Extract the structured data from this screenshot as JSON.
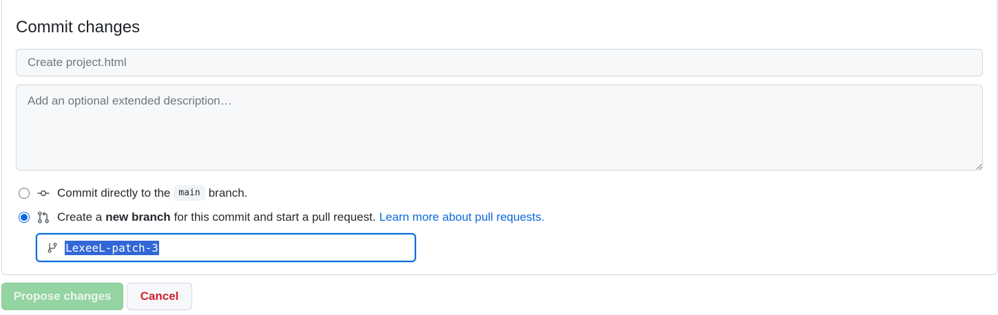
{
  "commit": {
    "title": "Commit changes",
    "summary_placeholder": "Create project.html",
    "description_placeholder": "Add an optional extended description…"
  },
  "options": {
    "direct": {
      "prefix": "Commit directly to the",
      "branch": "main",
      "suffix": "branch.",
      "selected": false,
      "icon": "git-commit-icon"
    },
    "new_branch": {
      "prefix": "Create a",
      "bold": "new branch",
      "middle": "for this commit and start a pull request.",
      "link": "Learn more about pull requests.",
      "selected": true,
      "icon": "git-pull-request-icon"
    }
  },
  "branch_name": {
    "value": "LexeeL-patch-3",
    "icon": "git-branch-icon"
  },
  "buttons": {
    "propose": "Propose changes",
    "cancel": "Cancel"
  },
  "colors": {
    "accent": "#0969da",
    "propose_disabled": "#94d3a2",
    "cancel_text": "#cf222e",
    "border": "#d0d7de"
  }
}
